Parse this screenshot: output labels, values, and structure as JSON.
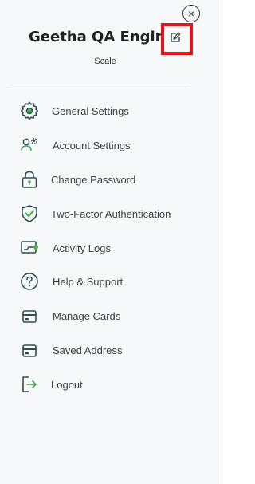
{
  "panel": {
    "close_glyph": "×",
    "profile_name": "Geetha QA Engineer",
    "subtitle": "Scale"
  },
  "menu": {
    "items": [
      {
        "label": "General Settings",
        "icon": "gear-icon"
      },
      {
        "label": "Account Settings",
        "icon": "user-gear-icon"
      },
      {
        "label": "Change Password",
        "icon": "lock-icon"
      },
      {
        "label": "Two-Factor Authentication",
        "icon": "shield-check-icon"
      },
      {
        "label": "Activity Logs",
        "icon": "activity-log-icon"
      },
      {
        "label": "Help & Support",
        "icon": "question-icon"
      },
      {
        "label": "Manage Cards",
        "icon": "card-icon"
      },
      {
        "label": "Saved Address",
        "icon": "address-card-icon"
      },
      {
        "label": "Logout",
        "icon": "logout-icon"
      }
    ]
  },
  "colors": {
    "icon_stroke": "#2f4f4f",
    "icon_accent": "#4caf50",
    "highlight": "#e3141b"
  }
}
